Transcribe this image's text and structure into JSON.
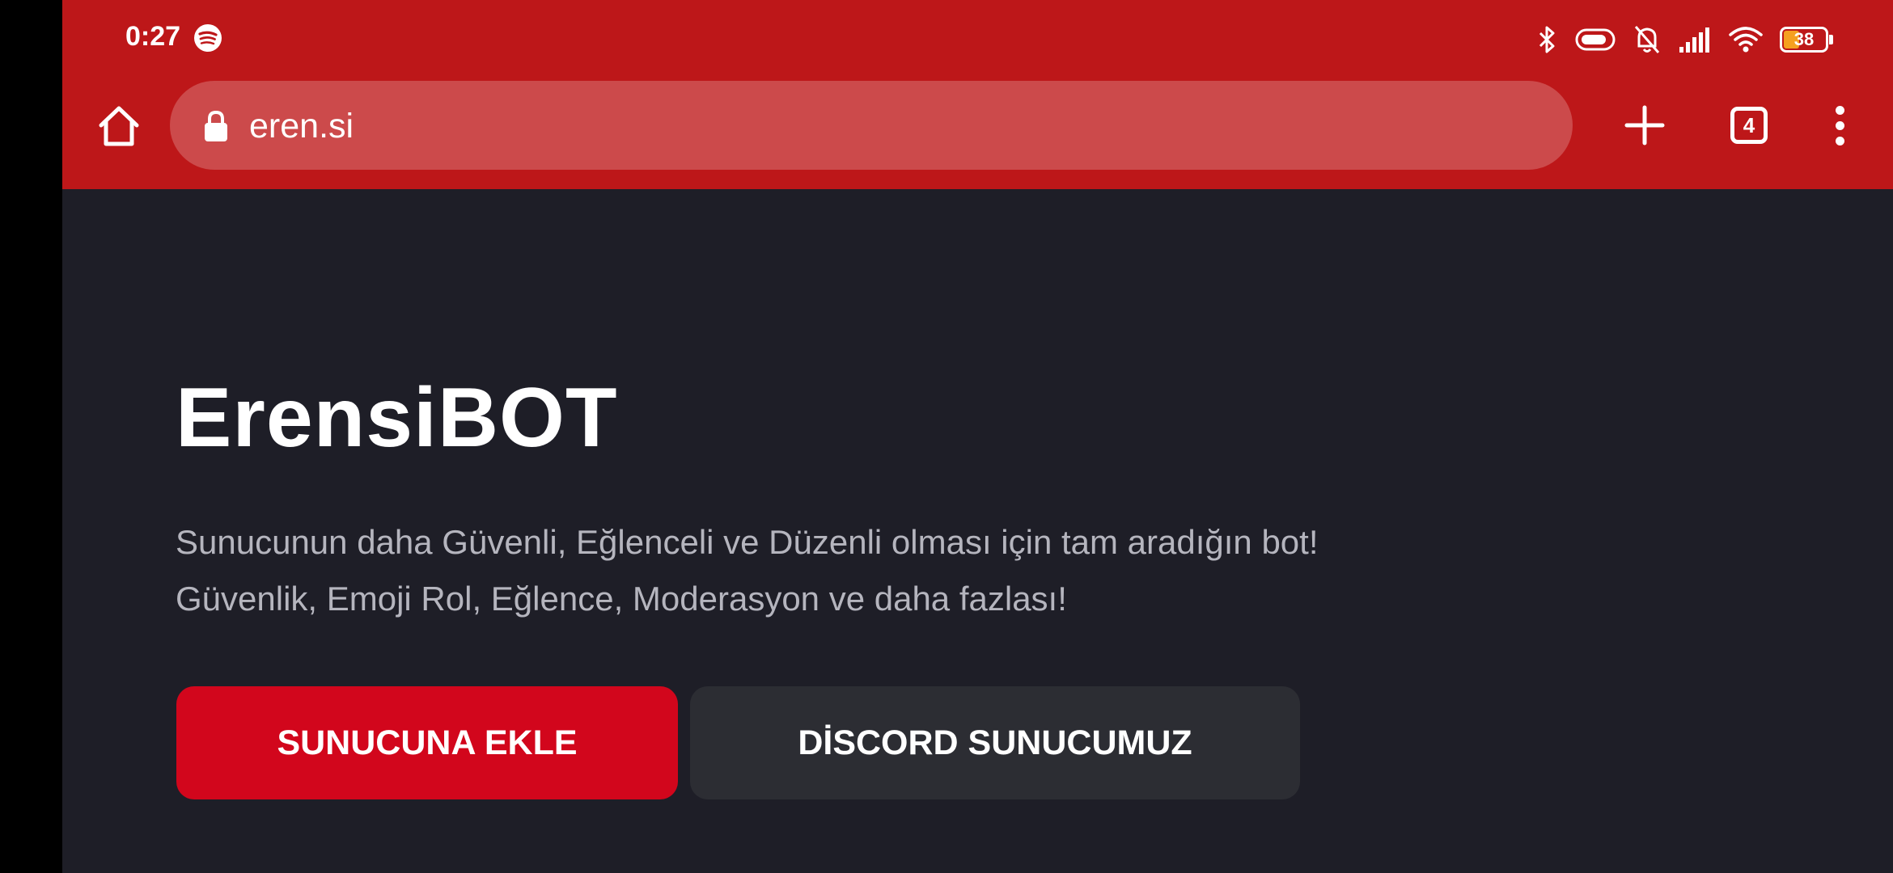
{
  "status_bar": {
    "time": "0:27",
    "battery_level": "38",
    "battery_fill_percent": 38,
    "icons": [
      "spotify-icon",
      "bluetooth-icon",
      "vibrate-icon",
      "notifications-off-icon",
      "signal-icon",
      "wifi-icon",
      "battery-icon"
    ]
  },
  "browser": {
    "url": "eren.si",
    "tab_count": "4",
    "toolbar_icons": [
      "home-icon",
      "lock-icon",
      "plus-icon",
      "tabs-icon",
      "more-vert-icon"
    ]
  },
  "hero": {
    "title": "ErensiBOT",
    "description_line1": "Sunucunun daha Güvenli, Eğlenceli ve Düzenli olması için tam aradığın bot!",
    "description_line2": "Güvenlik, Emoji Rol, Eğlence, Moderasyon ve daha fazlası!",
    "add_button": "SUNUCUNA EKLE",
    "discord_button": "DİSCORD SUNUCUMUZ"
  },
  "colors": {
    "chrome_red": "#bd1719",
    "omnibox": "#cc4a4b",
    "page_bg": "#1e1e27",
    "primary_button": "#d2061c",
    "secondary_button": "#2c2d33"
  }
}
